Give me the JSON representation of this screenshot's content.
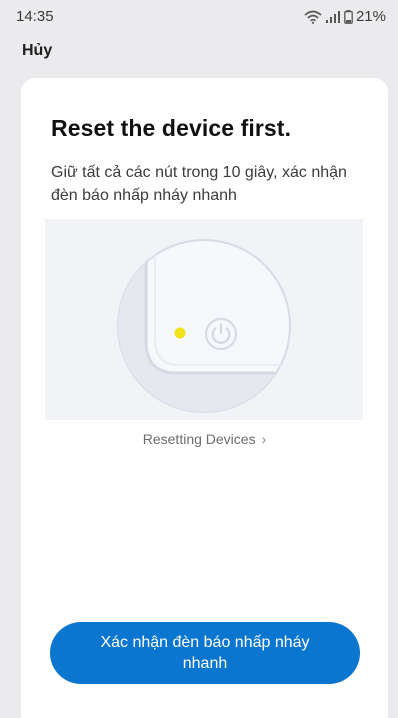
{
  "status_bar": {
    "time": "14:35",
    "battery": "21%"
  },
  "header": {
    "cancel_label": "Hủy"
  },
  "card": {
    "title": "Reset the device first.",
    "instruction": "Giữ tất cả các nút trong 10 giây, xác nhận đèn báo nhấp nháy nhanh",
    "illustration": {
      "indicator_color": "#f2e21a",
      "icon": "power-icon"
    },
    "resetting_link_label": "Resetting Devices",
    "resetting_link_icon": "chevron-right-icon",
    "confirm_button_label": "Xác nhận đèn báo nhấp nháy nhanh"
  },
  "colors": {
    "accent": "#0a76cf",
    "background": "#ebebee",
    "card": "#ffffff"
  }
}
